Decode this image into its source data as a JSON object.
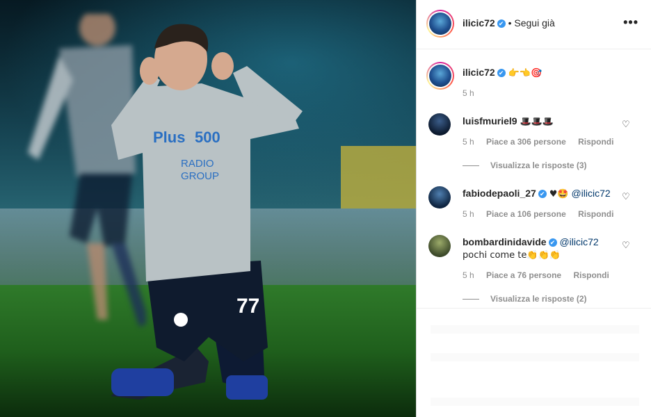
{
  "post": {
    "author": "ilicic72",
    "follow_status": "• Segui già",
    "more_label": "•••",
    "caption": "👉👈🎯",
    "caption_time": "5 h"
  },
  "comments": [
    {
      "username": "luisfmuriel9",
      "text": "🎩🎩🎩",
      "verified": false,
      "time": "5 h",
      "likes": "Piace a 306 persone",
      "reply": "Rispondi",
      "view_replies": "Visualizza le risposte (3)"
    },
    {
      "username": "fabiodepaoli_27",
      "text": "♥🤩",
      "mention": "@ilicic72",
      "verified": true,
      "time": "5 h",
      "likes": "Piace a 106 persone",
      "reply": "Rispondi"
    },
    {
      "username": "bombardinidavide",
      "mention": "@ilicic72",
      "text2": "pochi come te👏👏👏",
      "verified": true,
      "time": "5 h",
      "likes": "Piace a 76 persone",
      "reply": "Rispondi",
      "view_replies": "Visualizza le risposte (2)"
    }
  ],
  "icons": {
    "verified": "✔",
    "heart": "♡"
  },
  "colors": {
    "link": "#00376b",
    "muted": "#8e8e8e",
    "verified": "#3897f0"
  }
}
